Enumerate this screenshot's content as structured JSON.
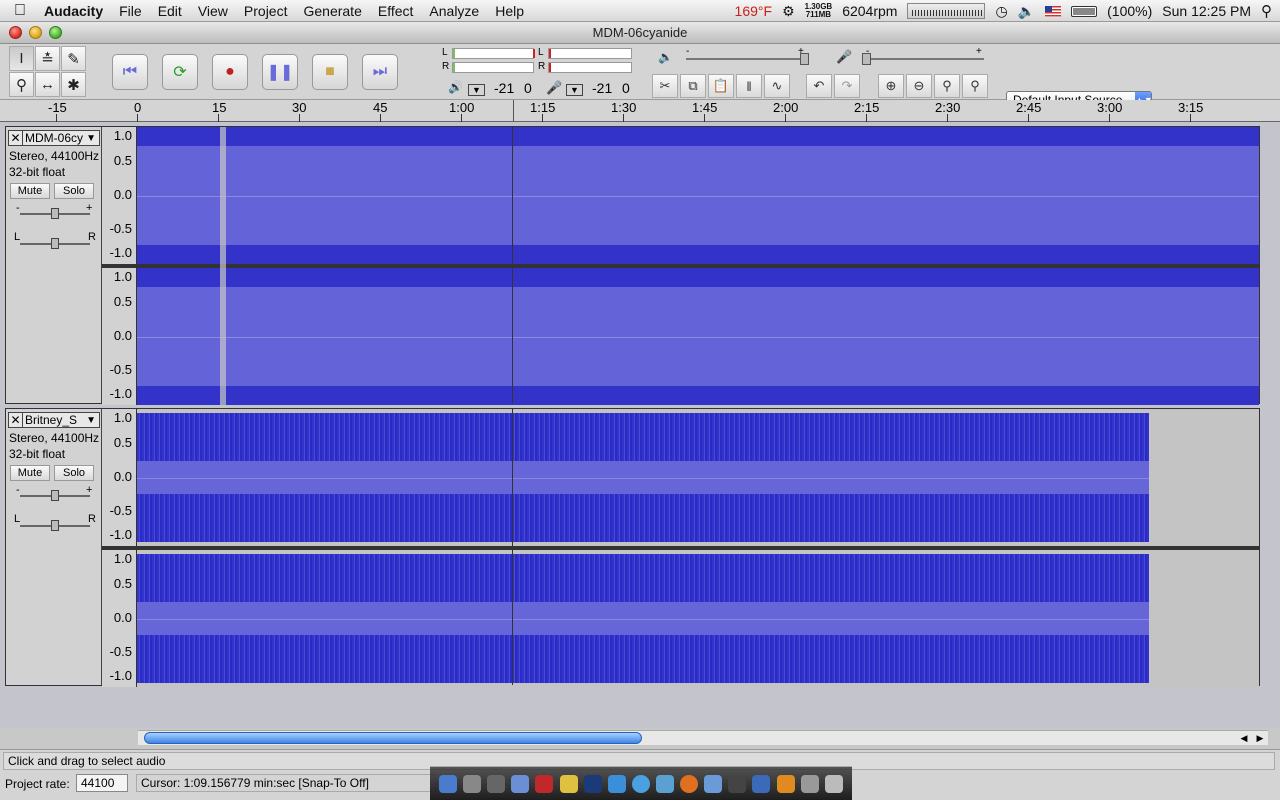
{
  "menubar": {
    "app_name": "Audacity",
    "menus": [
      "File",
      "Edit",
      "View",
      "Project",
      "Generate",
      "Effect",
      "Analyze",
      "Help"
    ],
    "status": {
      "temperature": "169°F",
      "memory_top": "1.30GB",
      "memory_bottom": "711MB",
      "fan": "6204rpm",
      "battery": "(100%)",
      "clock": "Sun 12:25 PM"
    }
  },
  "window": {
    "title": "MDM-06cyanide"
  },
  "toolbar": {
    "meter": {
      "out_l": "L",
      "out_r": "R",
      "in_l": "L",
      "in_r": "R",
      "out_db": "-21",
      "out_zero": "0",
      "in_db": "-21",
      "in_zero": "0"
    },
    "input_source": "Default Input Source",
    "gain_minus": "-",
    "gain_plus": "+"
  },
  "ruler": {
    "labels": [
      "-15",
      "0",
      "15",
      "30",
      "45",
      "1:00",
      "1:15",
      "1:30",
      "1:45",
      "2:00",
      "2:15",
      "2:30",
      "2:45",
      "3:00",
      "3:15"
    ]
  },
  "tracks": [
    {
      "name": "MDM-06cy",
      "format": "Stereo, 44100Hz",
      "bitdepth": "32-bit float",
      "mute": "Mute",
      "solo": "Solo",
      "gain_minus": "-",
      "gain_plus": "+",
      "pan_left": "L",
      "pan_right": "R",
      "scale": [
        "1.0",
        "0.5",
        "0.0",
        "-0.5",
        "-1.0"
      ]
    },
    {
      "name": "Britney_S",
      "format": "Stereo, 44100Hz",
      "bitdepth": "32-bit float",
      "mute": "Mute",
      "solo": "Solo",
      "gain_minus": "-",
      "gain_plus": "+",
      "pan_left": "L",
      "pan_right": "R",
      "scale": [
        "1.0",
        "0.5",
        "0.0",
        "-0.5",
        "-1.0"
      ]
    }
  ],
  "statusbar": {
    "hint": "Click and drag to select audio",
    "project_rate_label": "Project rate:",
    "project_rate": "44100",
    "cursor": "Cursor: 1:09.156779 min:sec    [Snap-To Off]"
  },
  "colors": {
    "waveform": "#3333c9",
    "waveform_rms": "#6464d8",
    "scroll_thumb": "#3f85e6"
  }
}
